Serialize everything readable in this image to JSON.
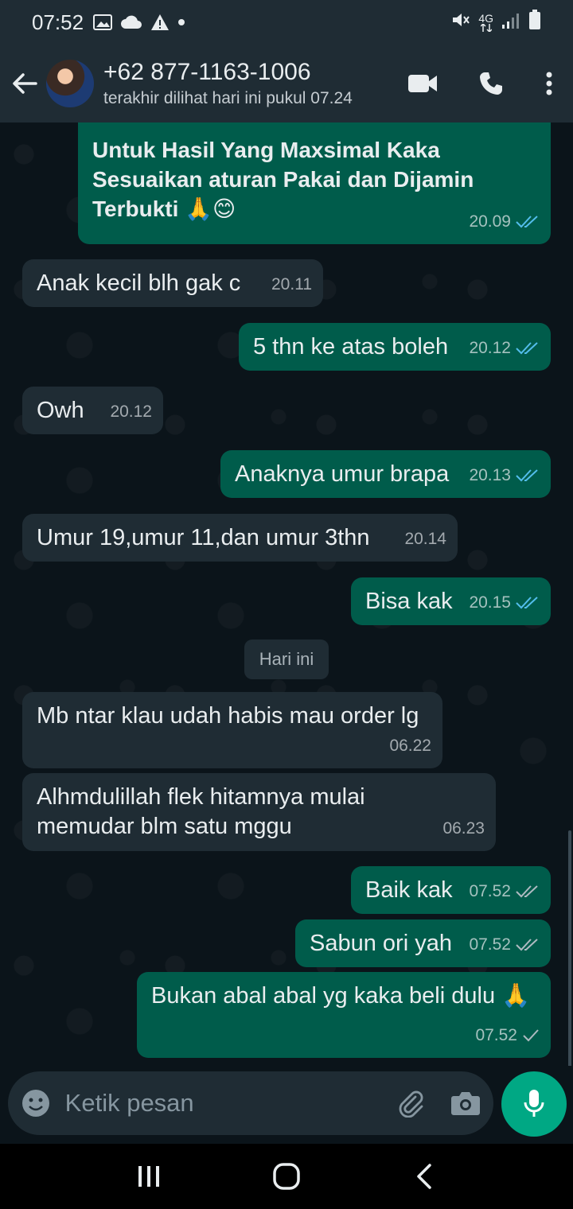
{
  "status_bar": {
    "time": "07:52",
    "icons": [
      "image-icon",
      "cloud-icon",
      "warning-icon",
      "dot-icon"
    ],
    "right_icons": [
      "mute-icon",
      "network-4g-icon",
      "signal-icon",
      "battery-icon"
    ],
    "network_label": "4G"
  },
  "header": {
    "contact_name": "+62 877-1163-1006",
    "last_seen": "terakhir dilihat hari ini pukul 07.24",
    "actions": [
      "video-call-icon",
      "voice-call-icon",
      "more-menu-icon"
    ]
  },
  "messages": [
    {
      "dir": "out",
      "text": "Untuk Hasil Yang Maxsimal Kaka\nSesuaikan aturan Pakai dan Dijamin\nTerbukti 🙏😊",
      "time": "20.09",
      "status": "read"
    },
    {
      "dir": "in",
      "text": "Anak kecil blh gak c",
      "time": "20.11"
    },
    {
      "dir": "out",
      "text": "5 thn ke atas boleh",
      "time": "20.12",
      "status": "read"
    },
    {
      "dir": "in",
      "text": "Owh",
      "time": "20.12"
    },
    {
      "dir": "out",
      "text": "Anaknya umur brapa",
      "time": "20.13",
      "status": "read"
    },
    {
      "dir": "in",
      "text": "Umur 19,umur 11,dan umur 3thn",
      "time": "20.14"
    },
    {
      "dir": "out",
      "text": "Bisa kak",
      "time": "20.15",
      "status": "read"
    },
    {
      "dir": "in",
      "text": "Mb ntar klau udah habis mau order lg",
      "time": "06.22"
    },
    {
      "dir": "in",
      "text": "Alhmdulillah flek hitamnya mulai\nmemudar blm satu mggu",
      "time": "06.23"
    },
    {
      "dir": "out",
      "text": "Baik kak",
      "time": "07.52",
      "status": "delivered"
    },
    {
      "dir": "out",
      "text": "Sabun ori yah",
      "time": "07.52",
      "status": "delivered"
    },
    {
      "dir": "out",
      "text": "Bukan abal abal yg kaka beli dulu 🙏",
      "time": "07.52",
      "status": "sent"
    }
  ],
  "date_divider": "Hari ini",
  "input": {
    "placeholder": "Ketik pesan",
    "left_icon": "emoji-icon",
    "right_icons": [
      "attach-icon",
      "camera-icon"
    ],
    "send_icon": "mic-icon"
  },
  "colors": {
    "background": "#0b141a",
    "header": "#1f2c34",
    "incoming_bubble": "#1f2c34",
    "outgoing_bubble": "#005c4b",
    "accent": "#00a884",
    "read_tick": "#53bdeb"
  },
  "nav_bar": {
    "buttons": [
      "recent-apps-icon",
      "home-icon",
      "back-nav-icon"
    ]
  }
}
